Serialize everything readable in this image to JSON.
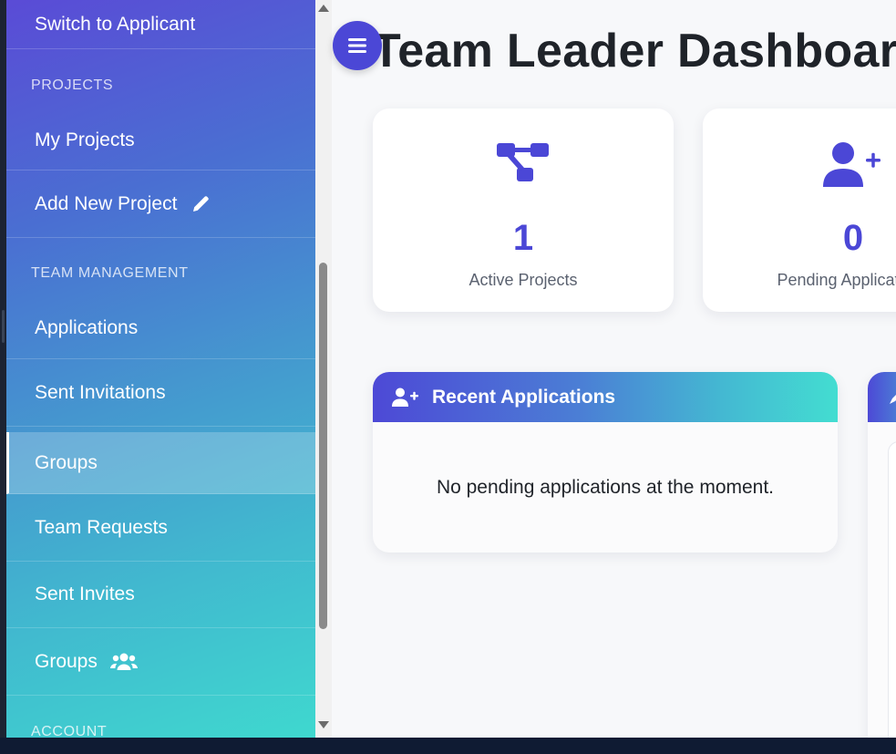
{
  "sidebar": {
    "switch_label": "Switch to Applicant",
    "sections": {
      "projects": "PROJECTS",
      "team_management": "TEAM MANAGEMENT",
      "account": "ACCOUNT"
    },
    "items": {
      "my_projects": "My Projects",
      "add_new_project": "Add New Project",
      "applications": "Applications",
      "sent_invitations": "Sent Invitations",
      "groups": "Groups",
      "team_requests": "Team Requests",
      "sent_invites": "Sent Invites",
      "groups_2": "Groups"
    },
    "active_item": "Groups",
    "icons": {
      "add_new_project": "pencil-icon",
      "groups_2": "users-icon"
    }
  },
  "main": {
    "menu_icon": "menu-icon",
    "title": "Team Leader Dashboard",
    "stats": [
      {
        "value": "1",
        "label": "Active Projects",
        "icon": "project-diagram-icon"
      },
      {
        "value": "0",
        "label": "Pending Applications",
        "icon": "user-plus-icon"
      }
    ],
    "recent_applications": {
      "title": "Recent Applications",
      "icon": "user-plus-icon",
      "empty_message": "No pending applications at the moment."
    }
  },
  "colors": {
    "accent": "#4b47d6",
    "sidebar_gradient_start": "#5a4bd6",
    "sidebar_gradient_end": "#3fd8cf",
    "title_text": "#1f2329"
  }
}
